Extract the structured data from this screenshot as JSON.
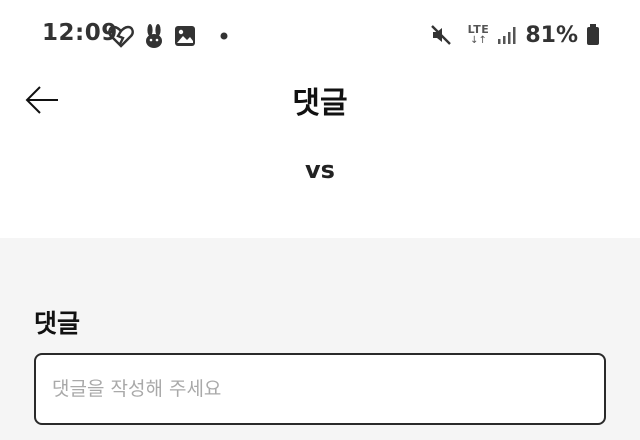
{
  "status_bar": {
    "time": "12:09",
    "network_label": "LTE",
    "network_arrows": "↓↑",
    "battery_percent": "81%",
    "icons": [
      "heart-broken-icon",
      "rabbit-icon",
      "image-icon",
      "dot-icon",
      "mute-icon",
      "signal-icon",
      "battery-icon"
    ]
  },
  "app_bar": {
    "title": "댓글",
    "back_icon": "arrow-left-icon"
  },
  "post": {
    "title": "vs"
  },
  "comments": {
    "heading": "댓글",
    "input_placeholder": "댓글을 작성해 주세요",
    "input_value": ""
  },
  "colors": {
    "page_background": "#ffffff",
    "section_background": "#f5f5f5",
    "text_primary": "#111111",
    "placeholder": "#a9a9a9",
    "input_border": "#2a2a2a"
  }
}
